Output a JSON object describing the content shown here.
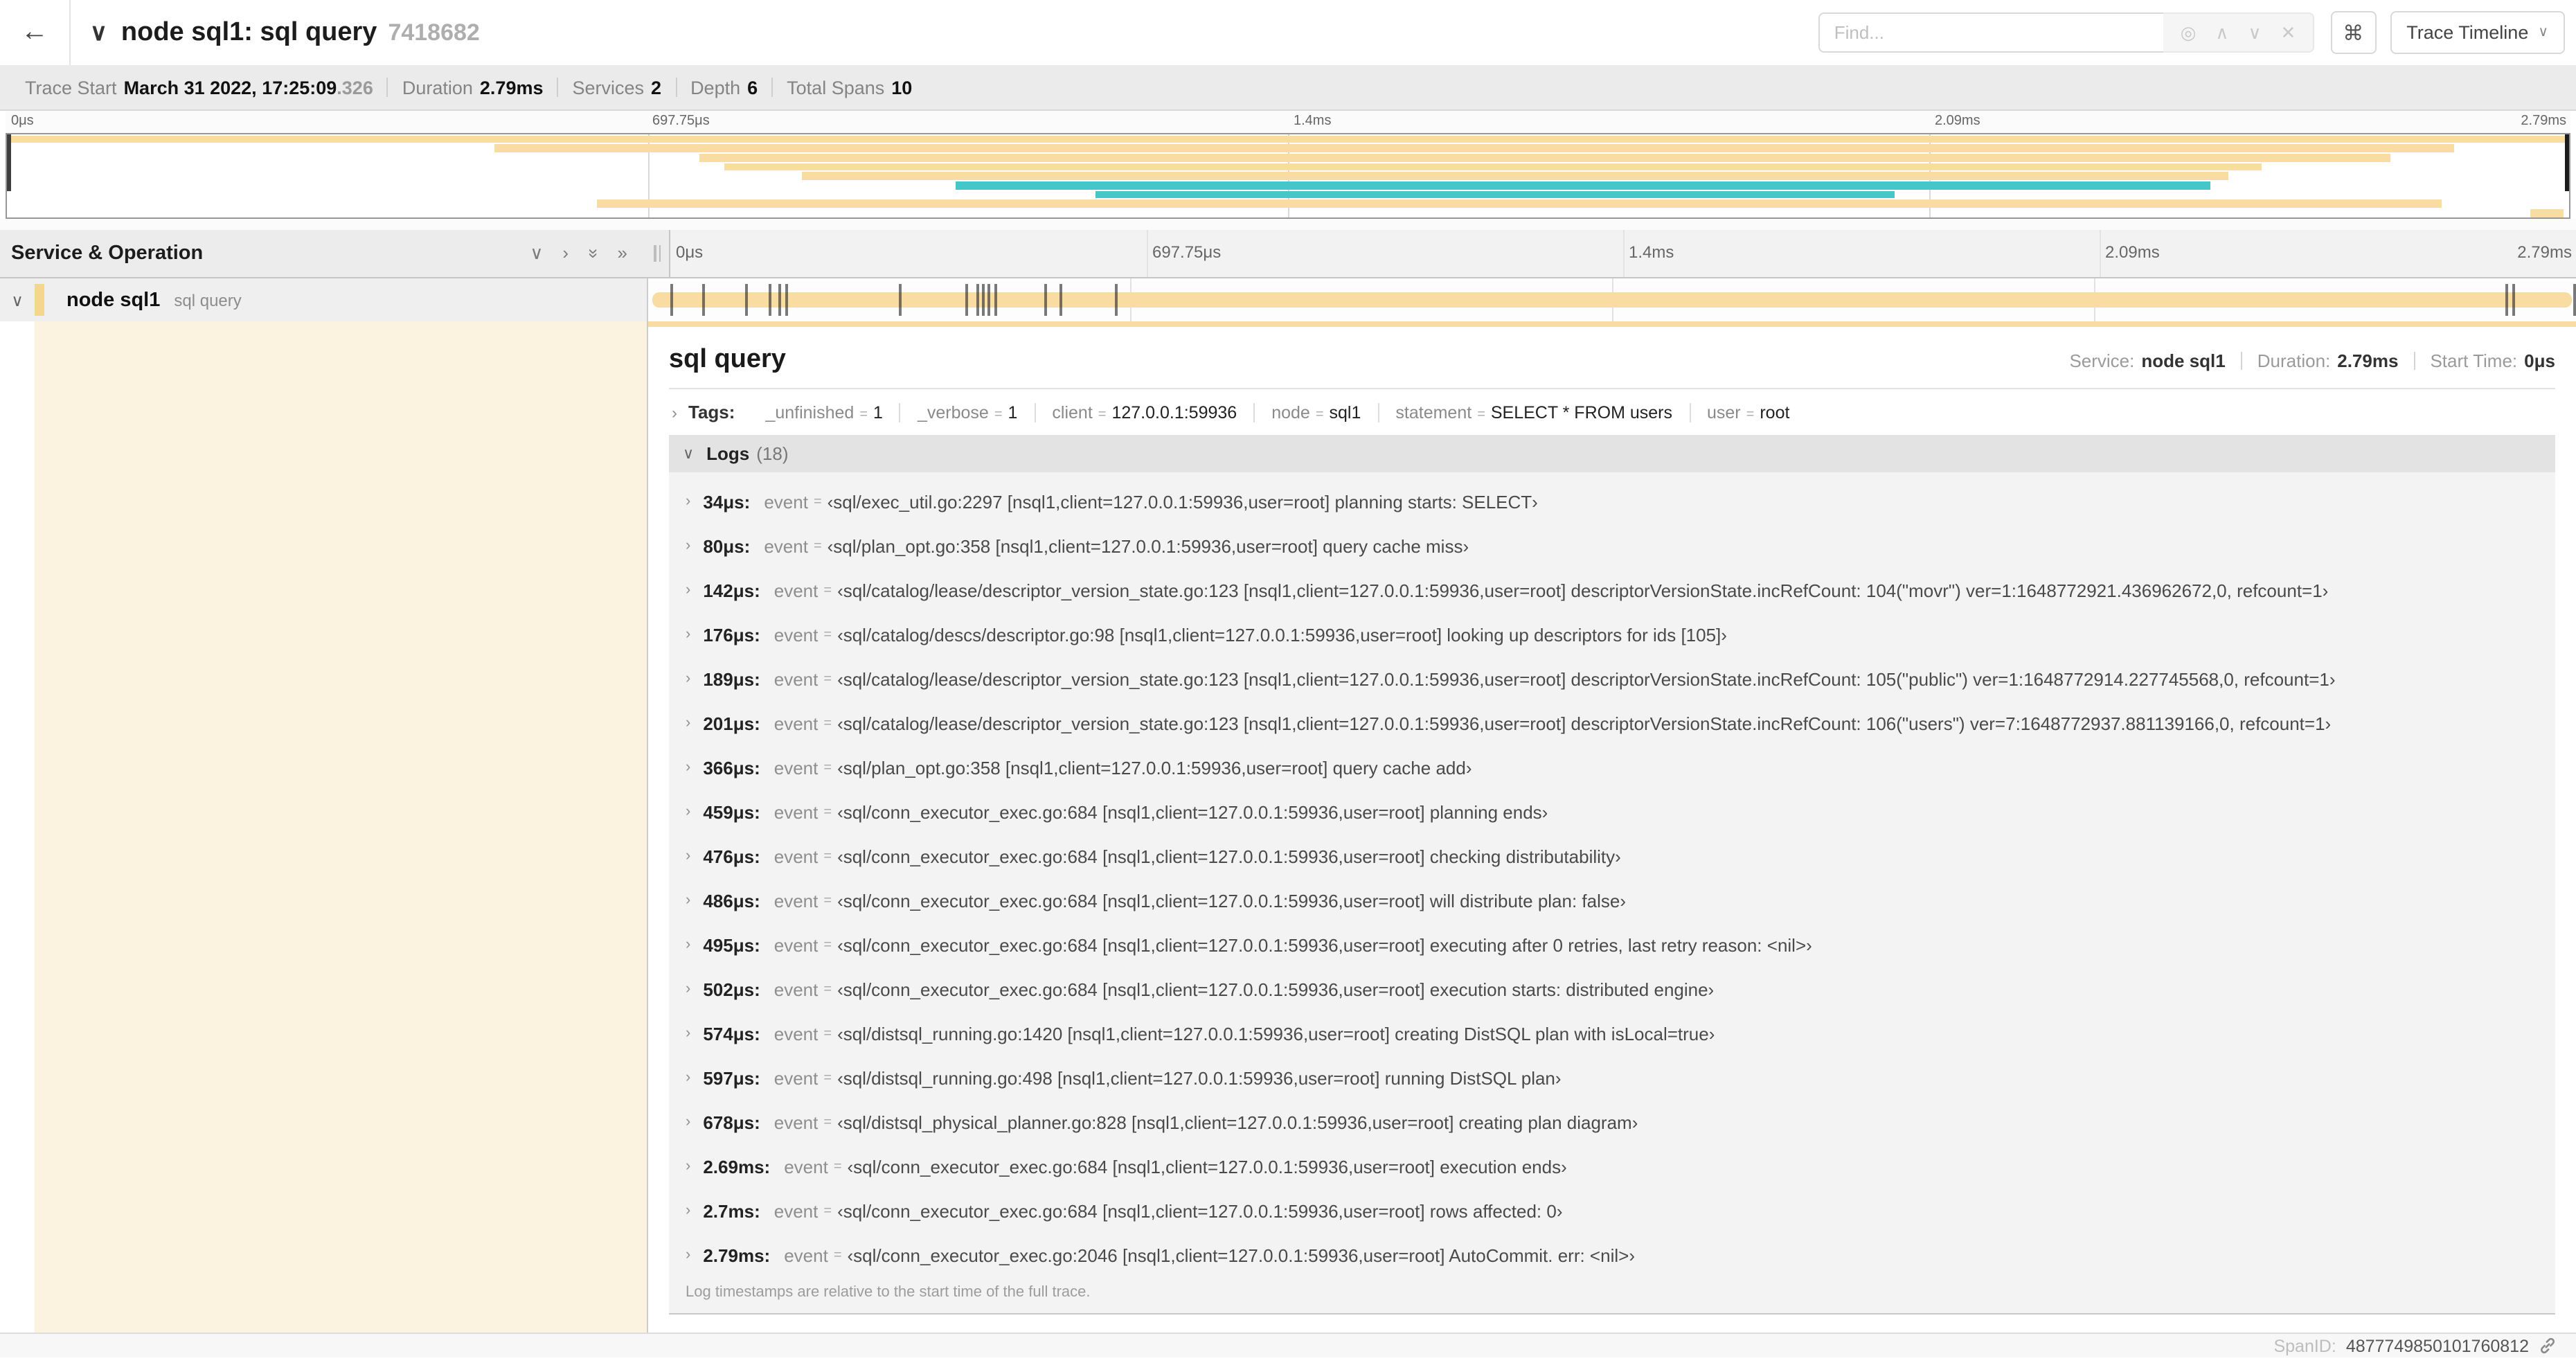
{
  "header": {
    "back_icon": "←",
    "collapse_icon": "∨",
    "title": "node sql1: sql query",
    "trace_id": "7418682",
    "find_placeholder": "Find...",
    "shortcut_icon": "⌘",
    "trace_timeline_label": "Trace Timeline"
  },
  "summary": [
    {
      "label": "Trace Start",
      "value": "March 31 2022, 17:25:09",
      "muted_suffix": ".326"
    },
    {
      "label": "Duration",
      "value": "2.79ms"
    },
    {
      "label": "Services",
      "value": "2"
    },
    {
      "label": "Depth",
      "value": "6"
    },
    {
      "label": "Total Spans",
      "value": "10"
    }
  ],
  "timeline": {
    "tick_labels": [
      "0μs",
      "697.75μs",
      "1.4ms",
      "2.09ms",
      "2.79ms"
    ],
    "tick_fractions": [
      0,
      0.25,
      0.5,
      0.75,
      1
    ],
    "grid_fractions": [
      0.25,
      0.5,
      0.75
    ]
  },
  "minimap": {
    "spans": [
      {
        "start": 0,
        "end": 1,
        "color": "orange"
      },
      {
        "start": 0.19,
        "end": 0.955,
        "color": "orange"
      },
      {
        "start": 0.27,
        "end": 0.93,
        "color": "orange"
      },
      {
        "start": 0.28,
        "end": 0.88,
        "color": "orange"
      },
      {
        "start": 0.31,
        "end": 0.867,
        "color": "orange"
      },
      {
        "start": 0.37,
        "end": 0.86,
        "color": "teal"
      },
      {
        "start": 0.425,
        "end": 0.737,
        "color": "teal"
      },
      {
        "start": 0.23,
        "end": 0.95,
        "color": "orange"
      },
      {
        "start": 0.985,
        "end": 0.998,
        "color": "orange"
      }
    ]
  },
  "span_list": {
    "header": "Service & Operation",
    "rows": [
      {
        "service": "node sql1",
        "operation": "sql query",
        "log_fractions": [
          0.012,
          0.029,
          0.051,
          0.063,
          0.068,
          0.072,
          0.131,
          0.165,
          0.171,
          0.174,
          0.177,
          0.18,
          0.206,
          0.214,
          0.243,
          0.964,
          0.968,
          0.999
        ]
      }
    ]
  },
  "detail": {
    "title": "sql query",
    "meta": [
      {
        "label": "Service:",
        "value": "node sql1"
      },
      {
        "label": "Duration:",
        "value": "2.79ms"
      },
      {
        "label": "Start Time:",
        "value": "0μs"
      }
    ],
    "tags_label": "Tags:",
    "tags": [
      {
        "key": "_unfinished",
        "value": "1"
      },
      {
        "key": "_verbose",
        "value": "1"
      },
      {
        "key": "client",
        "value": "127.0.0.1:59936"
      },
      {
        "key": "node",
        "value": "sql1"
      },
      {
        "key": "statement",
        "value": "SELECT * FROM users"
      },
      {
        "key": "user",
        "value": "root"
      }
    ],
    "logs_label": "Logs",
    "logs_count": "(18)",
    "log_field": "event",
    "logs": [
      {
        "time": "34μs:",
        "value": "‹sql/exec_util.go:2297 [nsql1,client=127.0.0.1:59936,user=root] planning starts: SELECT›"
      },
      {
        "time": "80μs:",
        "value": "‹sql/plan_opt.go:358 [nsql1,client=127.0.0.1:59936,user=root] query cache miss›"
      },
      {
        "time": "142μs:",
        "value": "‹sql/catalog/lease/descriptor_version_state.go:123 [nsql1,client=127.0.0.1:59936,user=root] descriptorVersionState.incRefCount: 104(\"movr\") ver=1:1648772921.436962672,0, refcount=1›"
      },
      {
        "time": "176μs:",
        "value": "‹sql/catalog/descs/descriptor.go:98 [nsql1,client=127.0.0.1:59936,user=root] looking up descriptors for ids [105]›"
      },
      {
        "time": "189μs:",
        "value": "‹sql/catalog/lease/descriptor_version_state.go:123 [nsql1,client=127.0.0.1:59936,user=root] descriptorVersionState.incRefCount: 105(\"public\") ver=1:1648772914.227745568,0, refcount=1›"
      },
      {
        "time": "201μs:",
        "value": "‹sql/catalog/lease/descriptor_version_state.go:123 [nsql1,client=127.0.0.1:59936,user=root] descriptorVersionState.incRefCount: 106(\"users\") ver=7:1648772937.881139166,0, refcount=1›"
      },
      {
        "time": "366μs:",
        "value": "‹sql/plan_opt.go:358 [nsql1,client=127.0.0.1:59936,user=root] query cache add›"
      },
      {
        "time": "459μs:",
        "value": "‹sql/conn_executor_exec.go:684 [nsql1,client=127.0.0.1:59936,user=root] planning ends›"
      },
      {
        "time": "476μs:",
        "value": "‹sql/conn_executor_exec.go:684 [nsql1,client=127.0.0.1:59936,user=root] checking distributability›"
      },
      {
        "time": "486μs:",
        "value": "‹sql/conn_executor_exec.go:684 [nsql1,client=127.0.0.1:59936,user=root] will distribute plan: false›"
      },
      {
        "time": "495μs:",
        "value": "‹sql/conn_executor_exec.go:684 [nsql1,client=127.0.0.1:59936,user=root] executing after 0 retries, last retry reason: <nil>›"
      },
      {
        "time": "502μs:",
        "value": "‹sql/conn_executor_exec.go:684 [nsql1,client=127.0.0.1:59936,user=root] execution starts: distributed engine›"
      },
      {
        "time": "574μs:",
        "value": "‹sql/distsql_running.go:1420 [nsql1,client=127.0.0.1:59936,user=root] creating DistSQL plan with isLocal=true›"
      },
      {
        "time": "597μs:",
        "value": "‹sql/distsql_running.go:498 [nsql1,client=127.0.0.1:59936,user=root] running DistSQL plan›"
      },
      {
        "time": "678μs:",
        "value": "‹sql/distsql_physical_planner.go:828 [nsql1,client=127.0.0.1:59936,user=root] creating plan diagram›"
      },
      {
        "time": "2.69ms:",
        "value": "‹sql/conn_executor_exec.go:684 [nsql1,client=127.0.0.1:59936,user=root] execution ends›"
      },
      {
        "time": "2.7ms:",
        "value": "‹sql/conn_executor_exec.go:684 [nsql1,client=127.0.0.1:59936,user=root] rows affected: 0›"
      },
      {
        "time": "2.79ms:",
        "value": "‹sql/conn_executor_exec.go:2046 [nsql1,client=127.0.0.1:59936,user=root] AutoCommit. err: <nil>›"
      }
    ],
    "footnote": "Log timestamps are relative to the start time of the full trace.",
    "span_id_label": "SpanID:",
    "span_id": "4877749850101760812"
  },
  "colors": {
    "span_orange": "#F8DCA1",
    "span_accent": "#F5D68F",
    "span_tint": "#FBF2E0",
    "span_teal": "#45C6C9"
  }
}
